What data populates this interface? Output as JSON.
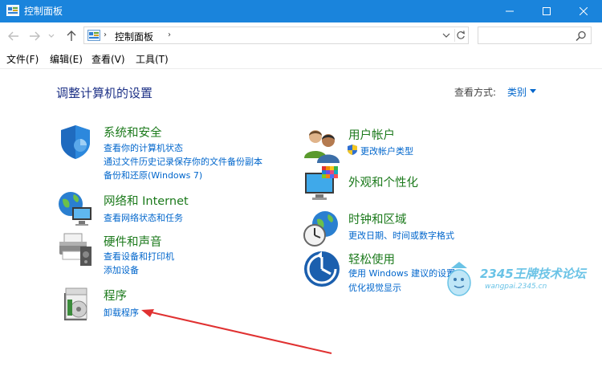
{
  "window": {
    "title": "控制面板"
  },
  "address": {
    "path": "控制面板",
    "search_placeholder": ""
  },
  "menu": [
    {
      "label": "文件(F)"
    },
    {
      "label": "编辑(E)"
    },
    {
      "label": "查看(V)"
    },
    {
      "label": "工具(T)"
    }
  ],
  "page": {
    "title": "调整计算机的设置",
    "view_by_label": "查看方式:",
    "view_by_value": "类别"
  },
  "categories": {
    "system": {
      "title": "系统和安全",
      "links": [
        "查看你的计算机状态",
        "通过文件历史记录保存你的文件备份副本",
        "备份和还原(Windows 7)"
      ],
      "icon": "shield-icon"
    },
    "network": {
      "title": "网络和 Internet",
      "links": [
        "查看网络状态和任务"
      ],
      "icon": "network-globe-icon"
    },
    "hardware": {
      "title": "硬件和声音",
      "links": [
        "查看设备和打印机",
        "添加设备"
      ],
      "icon": "printer-icon"
    },
    "programs": {
      "title": "程序",
      "links": [
        "卸载程序"
      ],
      "icon": "programs-icon"
    },
    "users": {
      "title": "用户帐户",
      "links": [
        "更改帐户类型"
      ],
      "icon": "users-icon"
    },
    "appearance": {
      "title": "外观和个性化",
      "links": [],
      "icon": "monitor-palette-icon"
    },
    "clock": {
      "title": "时钟和区域",
      "links": [
        "更改日期、时间或数字格式"
      ],
      "icon": "clock-globe-icon"
    },
    "ease": {
      "title": "轻松使用",
      "links": [
        "使用 Windows 建议的设置",
        "优化视觉显示"
      ],
      "icon": "ease-of-access-icon"
    }
  },
  "watermark": {
    "text": "2345王牌技术论坛",
    "sub": "wangpai.2345.cn"
  },
  "colors": {
    "titlebar": "#1a84dc",
    "category_title": "#1c7a1c",
    "link": "#0066cc",
    "annotation_arrow": "#e03131"
  }
}
